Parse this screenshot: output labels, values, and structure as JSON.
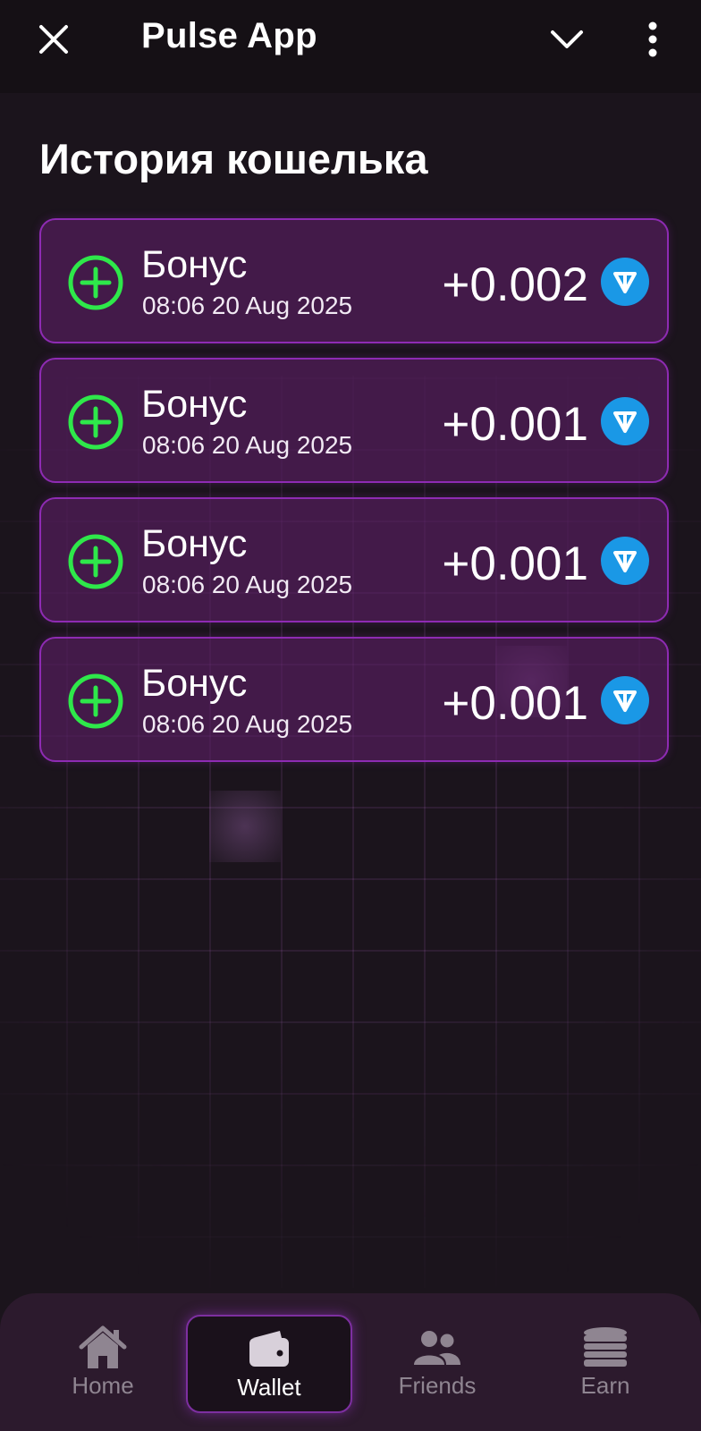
{
  "app": {
    "title": "Pulse App"
  },
  "page": {
    "title": "История кошелька"
  },
  "transactions": [
    {
      "label": "Бонус",
      "date": "08:06 20 Aug 2025",
      "amount": "+0.002",
      "currency_icon": "ton-icon"
    },
    {
      "label": "Бонус",
      "date": "08:06 20 Aug 2025",
      "amount": "+0.001",
      "currency_icon": "ton-icon"
    },
    {
      "label": "Бонус",
      "date": "08:06 20 Aug 2025",
      "amount": "+0.001",
      "currency_icon": "ton-icon"
    },
    {
      "label": "Бонус",
      "date": "08:06 20 Aug 2025",
      "amount": "+0.001",
      "currency_icon": "ton-icon"
    }
  ],
  "nav": {
    "items": [
      {
        "label": "Home",
        "icon": "home-icon",
        "active": false
      },
      {
        "label": "Wallet",
        "icon": "wallet-icon",
        "active": true
      },
      {
        "label": "Friends",
        "icon": "friends-icon",
        "active": false
      },
      {
        "label": "Earn",
        "icon": "coins-icon",
        "active": false
      }
    ]
  },
  "colors": {
    "accent": "#8e2bb3",
    "plus_green": "#2ee84a",
    "ton_blue": "#1a98e6",
    "background": "#1b141c"
  }
}
